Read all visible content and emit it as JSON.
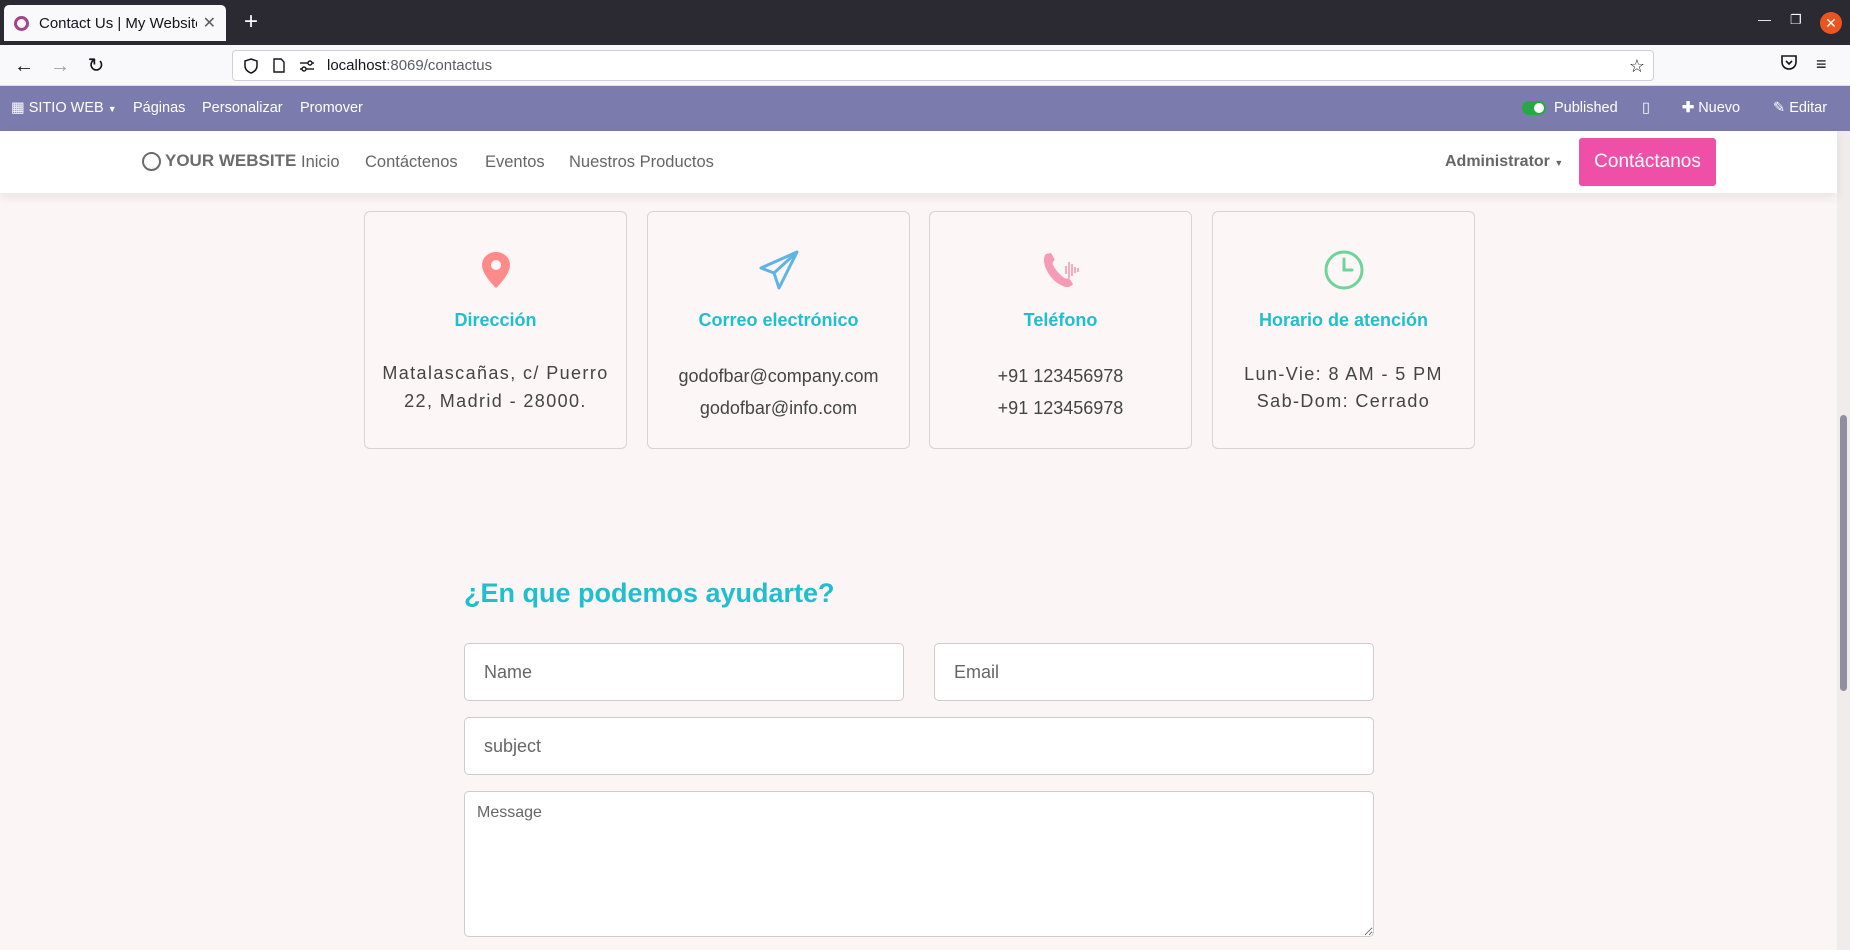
{
  "browser": {
    "tab_title": "Contact Us | My Website",
    "url_host": "localhost",
    "url_path": ":8069/contactus"
  },
  "odoo_bar": {
    "website_menu": "SITIO WEB",
    "pages": "Páginas",
    "customize": "Personalizar",
    "promote": "Promover",
    "published": "Published",
    "new": "Nuevo",
    "edit": "Editar"
  },
  "header": {
    "logo": "YOUR WEBSITE",
    "menu": [
      "Inicio",
      "Contáctenos",
      "Eventos",
      "Nuestros Productos"
    ],
    "user": "Administrator",
    "cta": "Contáctanos"
  },
  "cards": [
    {
      "title": "Dirección",
      "lines": [
        "Matalascañas, c/ Puerro",
        "22, Madrid - 28000."
      ],
      "icon": "map-pin-icon",
      "color": "#ff8a8a"
    },
    {
      "title": "Correo electrónico",
      "lines": [
        "godofbar@company.com",
        "godofbar@info.com"
      ],
      "icon": "paper-plane-icon",
      "color": "#5fb4e6"
    },
    {
      "title": "Teléfono",
      "lines": [
        "+91 123456978",
        "+91 123456978"
      ],
      "icon": "phone-icon",
      "color": "#f59bb5"
    },
    {
      "title": "Horario de atención",
      "lines": [
        "Lun-Vie: 8 AM - 5 PM",
        "Sab-Dom: Cerrado"
      ],
      "icon": "clock-icon",
      "color": "#6ed49a"
    }
  ],
  "form": {
    "title": "¿En que podemos ayudarte?",
    "name_placeholder": "Name",
    "email_placeholder": "Email",
    "subject_placeholder": "subject",
    "message_placeholder": "Message"
  },
  "colors": {
    "accent": "#1fbfcf",
    "cta": "#ef4fa6",
    "odoo_bar": "#7c7bad",
    "page_bg": "#fbf5f5"
  }
}
